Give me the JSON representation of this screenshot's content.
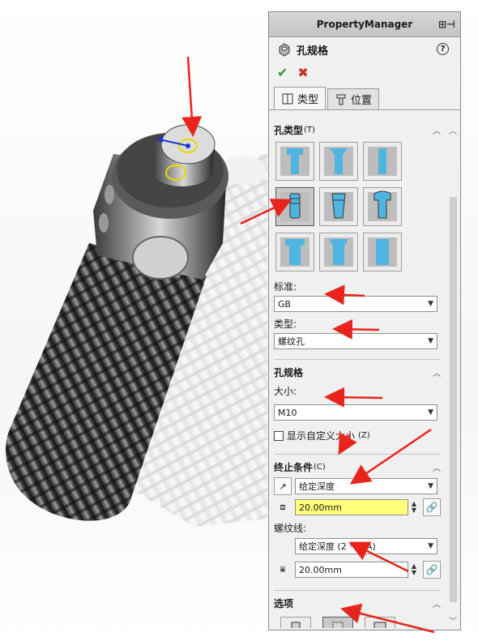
{
  "panel": {
    "title": "PropertyManager",
    "feature_name": "孔规格",
    "tabs": [
      {
        "label": "类型",
        "active": true
      },
      {
        "label": "位置",
        "active": false
      }
    ]
  },
  "hole_type": {
    "header": "孔类型",
    "shortcut": "(T)",
    "buttons": [
      "counterbore",
      "countersink",
      "straight-hole",
      "straight-tap",
      "tapered-tap",
      "legacy-hole",
      "counterbore-slot",
      "countersink-slot",
      "straight-slot"
    ],
    "selected_index": 3,
    "standard_label": "标准:",
    "standard_value": "GB",
    "type_label": "类型:",
    "type_value": "螺纹孔"
  },
  "hole_spec": {
    "header": "孔规格",
    "size_label": "大小:",
    "size_value": "M10",
    "custom_size_label": "显示自定义大小",
    "custom_size_shortcut": "(Z)"
  },
  "end_condition": {
    "header": "终止条件",
    "shortcut": "(C)",
    "condition_value": "给定深度",
    "depth_value": "20.00mm",
    "thread_label": "螺纹线:",
    "thread_condition_value": "给定深度 (2 * DIA)",
    "thread_depth_value": "20.00mm"
  },
  "options": {
    "header": "选项",
    "buttons": [
      "tap-drill-diameter",
      "cosmetic-thread",
      "remove-thread"
    ],
    "selected_index": 1
  },
  "colors": {
    "accent_red": "#e8241c",
    "highlight_yellow": "#ffff7a",
    "ok_green": "#2e9a2e",
    "hole_blue": "#4fb4e0"
  }
}
